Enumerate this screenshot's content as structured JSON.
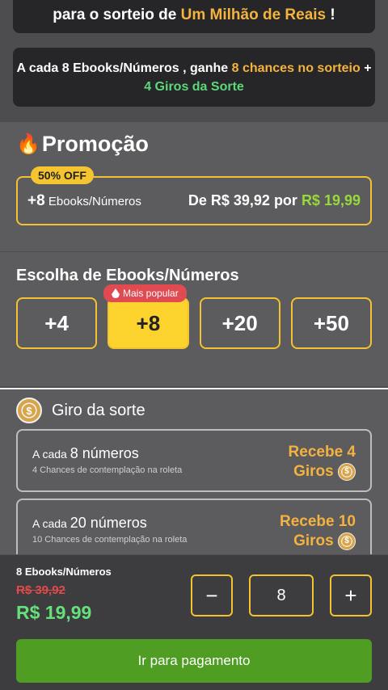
{
  "banner": {
    "line1_prefix": "para o sorteio de ",
    "line1_highlight": "Um Milhão de Reais",
    "line1_suffix": " !",
    "line2_prefix": "A cada 8 Ebooks/Números , ganhe ",
    "line2_highlight": "8 chances no sorteio",
    "line2_mid": " + ",
    "line2_green": "4 Giros da Sorte"
  },
  "promo": {
    "title": "Promoção",
    "badge": "50% OFF",
    "plus": "+8",
    "item": "Ebooks/Números",
    "from_text": "De R$ 39,92 por ",
    "price": "R$ 19,99"
  },
  "choose": {
    "title": "Escolha de Ebooks/Números",
    "popular": "Mais popular",
    "options": [
      "+4",
      "+8",
      "+20",
      "+50"
    ],
    "selected_index": 1
  },
  "giro": {
    "title": "Giro da sorte",
    "cards": [
      {
        "prefix": "A cada ",
        "number": "8 números",
        "sub": "4 Chances de contemplação na roleta",
        "reward1": "Recebe 4",
        "reward2": "Giros"
      },
      {
        "prefix": "A cada ",
        "number": "20 números",
        "sub": "10 Chances de contemplação na roleta",
        "reward1": "Recebe 10",
        "reward2": "Giros"
      }
    ]
  },
  "cart": {
    "label": "8 Ebooks/Números",
    "old_price": "R$ 39,92",
    "new_price": "R$ 19,99",
    "quantity": "8",
    "minus": "−",
    "plus": "+",
    "pay_label": "Ir para pagamento"
  },
  "colors": {
    "accent_yellow": "#f2c230",
    "orange_text": "#f4b23e",
    "green_price": "#65e07a",
    "pay_button": "#4f9d23",
    "popular_badge": "#e24a52"
  }
}
